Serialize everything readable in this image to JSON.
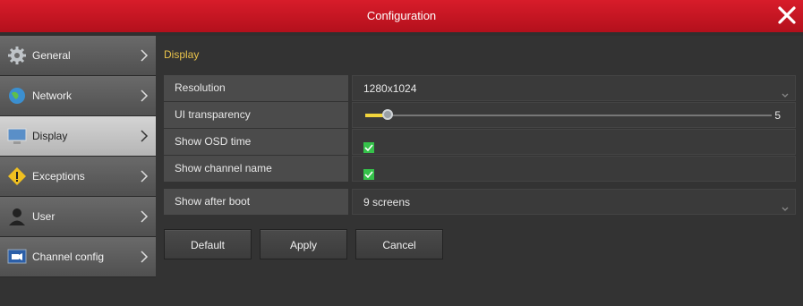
{
  "window": {
    "title": "Configuration"
  },
  "sidebar": {
    "items": [
      {
        "label": "General",
        "icon": "gear-icon"
      },
      {
        "label": "Network",
        "icon": "globe-icon"
      },
      {
        "label": "Display",
        "icon": "monitor-icon",
        "active": true
      },
      {
        "label": "Exceptions",
        "icon": "warning-icon"
      },
      {
        "label": "User",
        "icon": "user-icon"
      },
      {
        "label": "Channel config",
        "icon": "camera-channel-icon"
      }
    ]
  },
  "main": {
    "section_title": "Display",
    "rows": [
      {
        "label": "Resolution",
        "value": "1280x1024",
        "type": "dropdown"
      },
      {
        "label": "UI transparency",
        "value": "5",
        "type": "slider",
        "level_fraction": 0.05
      },
      {
        "label": "Show OSD time",
        "checked": true,
        "type": "checkbox"
      },
      {
        "label": "Show channel name",
        "checked": true,
        "type": "checkbox"
      },
      {
        "label": "Show after boot",
        "value": "9 screens",
        "type": "dropdown"
      }
    ],
    "buttons": {
      "default_label": "Default",
      "apply_label": "Apply",
      "cancel_label": "Cancel"
    }
  },
  "colors": {
    "titlebar": "#c8141f",
    "accent": "#e8c24a",
    "slider_fill": "#f2d53c",
    "checkbox": "#35c24a"
  }
}
